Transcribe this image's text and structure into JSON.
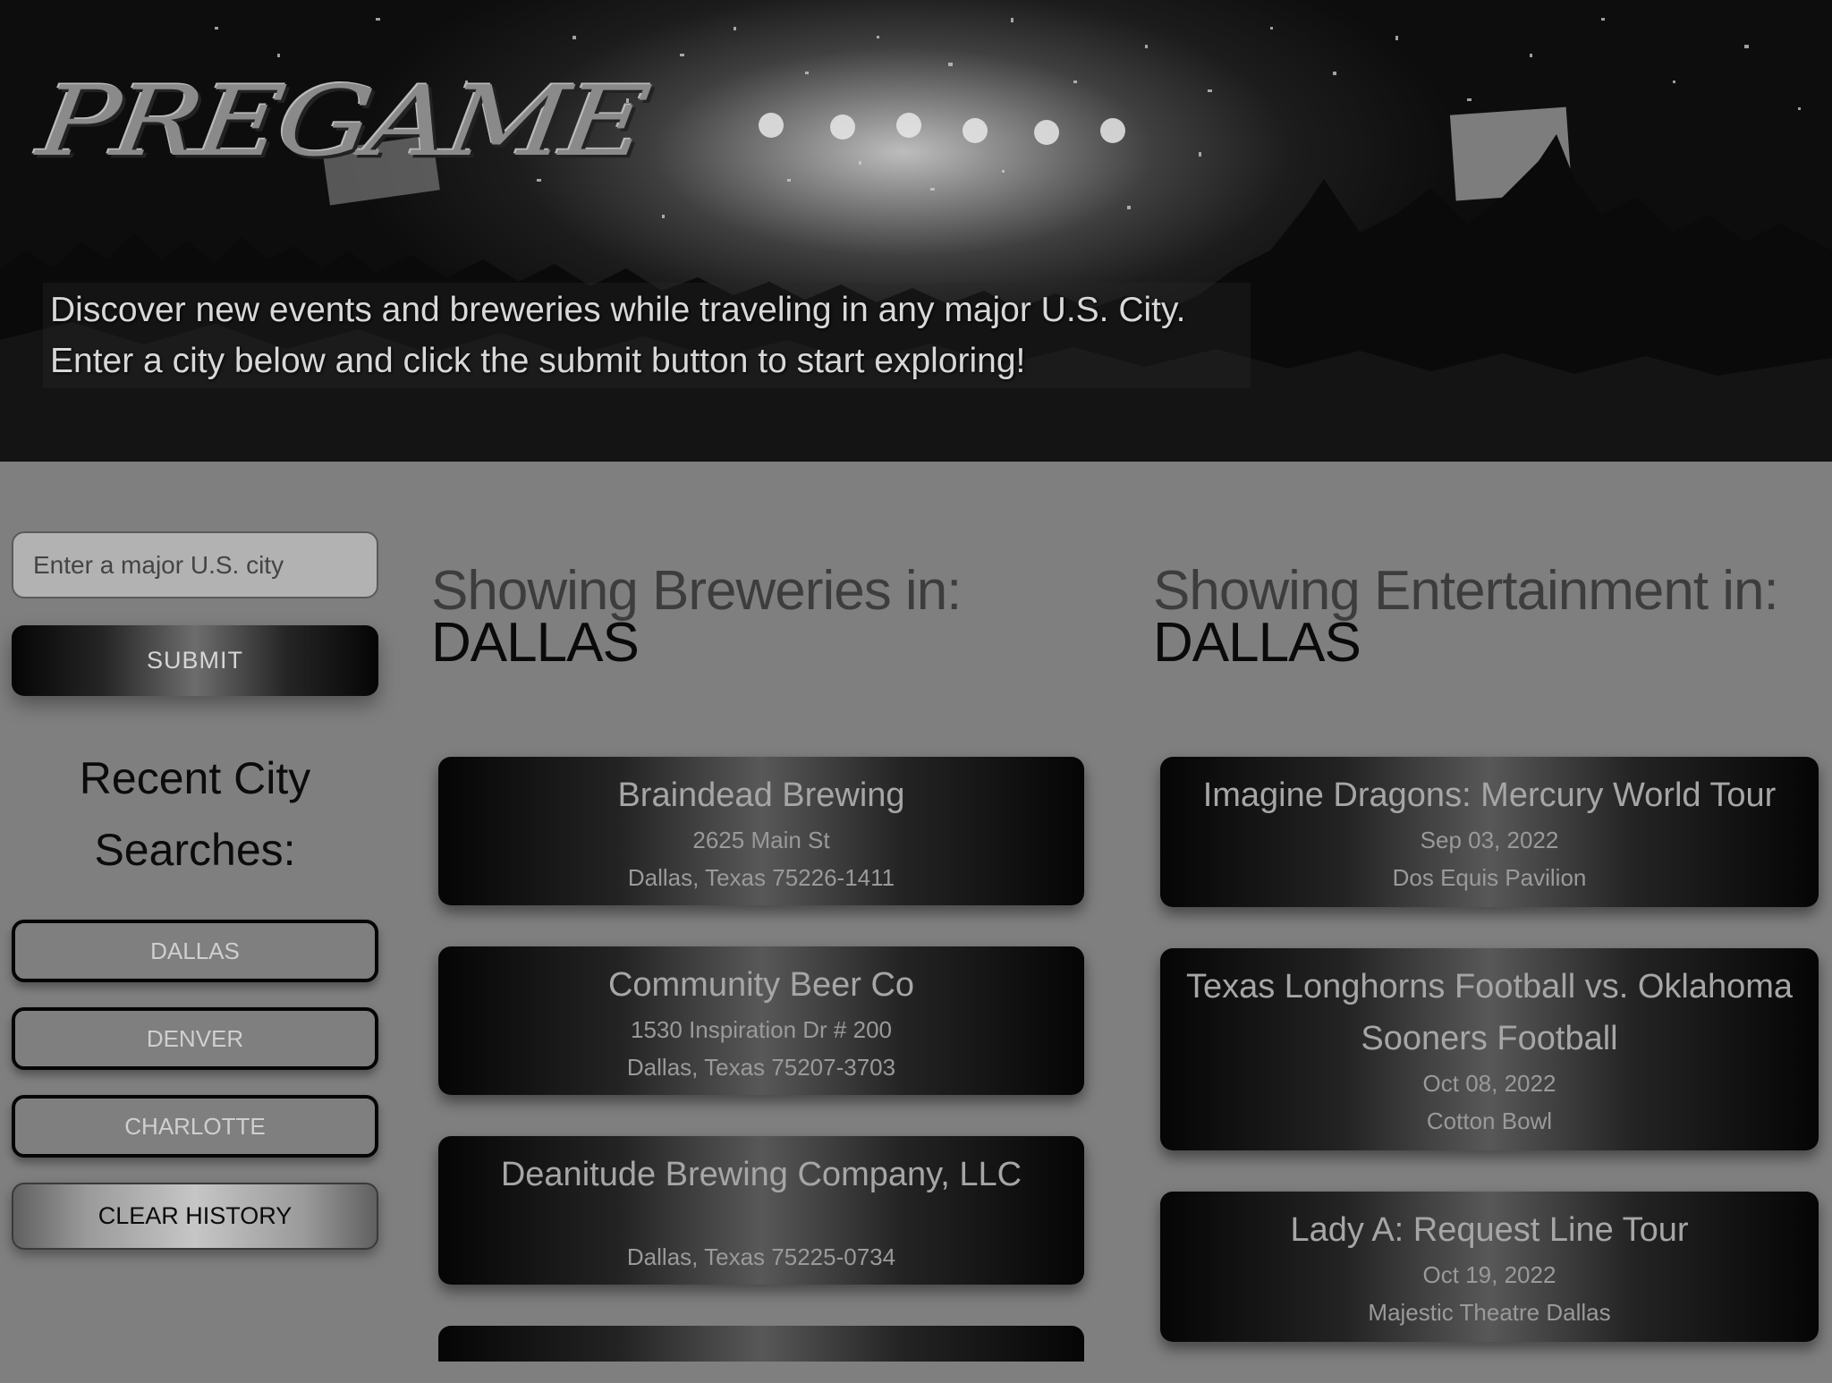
{
  "app": {
    "logo": "PREGAME",
    "tagline_line1": "Discover new events and breweries while traveling in any major U.S. City.",
    "tagline_line2": "Enter a city below and click the submit button to start exploring!"
  },
  "sidebar": {
    "search_placeholder": "Enter a major U.S. city",
    "search_value": "",
    "submit_label": "SUBMIT",
    "recent_title": "Recent City Searches:",
    "history": [
      "DALLAS",
      "DENVER",
      "CHARLOTTE"
    ],
    "clear_label": "CLEAR HISTORY"
  },
  "breweries": {
    "heading": "Showing Breweries in:",
    "city": "DALLAS",
    "items": [
      {
        "name": "Braindead Brewing",
        "street": "2625 Main St",
        "locality": "Dallas, Texas 75226-1411"
      },
      {
        "name": "Community Beer Co",
        "street": "1530 Inspiration Dr # 200",
        "locality": "Dallas, Texas 75207-3703"
      },
      {
        "name": "Deanitude Brewing Company, LLC",
        "street": "",
        "locality": "Dallas, Texas 75225-0734"
      }
    ]
  },
  "entertainment": {
    "heading": "Showing Entertainment in:",
    "city": "DALLAS",
    "items": [
      {
        "name": "Imagine Dragons: Mercury World Tour",
        "date": "Sep 03, 2022",
        "venue": "Dos Equis Pavilion"
      },
      {
        "name": "Texas Longhorns Football vs. Oklahoma Sooners Football",
        "date": "Oct 08, 2022",
        "venue": "Cotton Bowl"
      },
      {
        "name": "Lady A: Request Line Tour",
        "date": "Oct 19, 2022",
        "venue": "Majestic Theatre Dallas"
      }
    ]
  },
  "colors": {
    "page_bg": "#7f7f7f",
    "card_dark": "#050505",
    "card_light": "#585858",
    "text_dark": "#0a0a0a"
  }
}
